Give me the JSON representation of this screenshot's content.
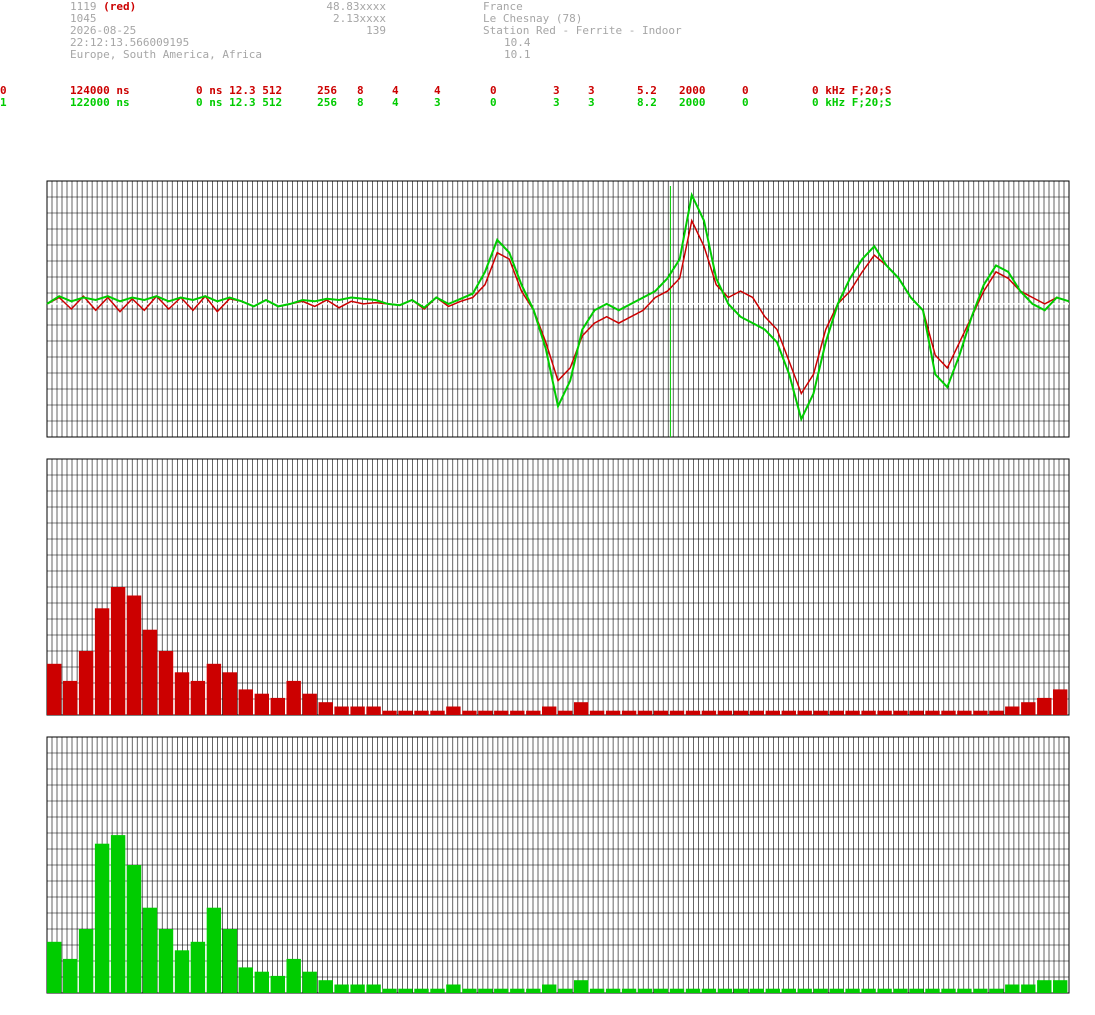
{
  "header": {
    "col1": [
      "1119",
      "1045",
      "2026-08-25",
      "22:12:13.566009195",
      "Europe, South America, Africa"
    ],
    "red_tag": "(red)",
    "col2": [
      "48.83xxxx",
      "2.13xxxx",
      "139"
    ],
    "col3": [
      "France",
      "Le Chesnay (78)",
      "Station Red - Ferrite - Indoor"
    ],
    "col3b": [
      "10.4",
      "10.1"
    ]
  },
  "channels": [
    {
      "id": "0",
      "f1": "124000 ns",
      "f2": "0 ns 12.3 512",
      "f3": "256",
      "f4": "8",
      "f5": "4",
      "f6": "4",
      "f7": "0",
      "f8": "3",
      "f9": "3",
      "f10": "5.2",
      "f11": "2000",
      "f12": "0",
      "f13": "0 kHz F;20;S"
    },
    {
      "id": "1",
      "f1": "122000 ns",
      "f2": "0 ns 12.3 512",
      "f3": "256",
      "f4": "8",
      "f5": "4",
      "f6": "3",
      "f7": "0",
      "f8": "3",
      "f9": "3",
      "f10": "8.2",
      "f11": "2000",
      "f12": "0",
      "f13": "0 kHz F;20;S"
    }
  ],
  "colors": {
    "red": "#cc0000",
    "green": "#00cc00",
    "grid": "#000000",
    "mid": "#ffffff"
  },
  "chart_data": [
    {
      "type": "line",
      "series": [
        {
          "key": "red",
          "values": [
            0,
            0.05,
            -0.04,
            0.06,
            -0.05,
            0.05,
            -0.06,
            0.04,
            -0.05,
            0.06,
            -0.04,
            0.05,
            -0.05,
            0.06,
            -0.06,
            0.04,
            0.02,
            -0.02,
            0.03,
            -0.02,
            0.0,
            0.02,
            -0.02,
            0.03,
            -0.03,
            0.02,
            0.0,
            0.01,
            0.0,
            -0.01,
            0.03,
            -0.04,
            0.05,
            -0.02,
            0.02,
            0.05,
            0.15,
            0.4,
            0.35,
            0.1,
            -0.05,
            -0.3,
            -0.6,
            -0.5,
            -0.25,
            -0.15,
            -0.1,
            -0.15,
            -0.1,
            -0.05,
            0.05,
            0.1,
            0.2,
            0.65,
            0.45,
            0.15,
            0.05,
            0.1,
            0.05,
            -0.1,
            -0.2,
            -0.45,
            -0.7,
            -0.55,
            -0.2,
            0.0,
            0.1,
            0.25,
            0.38,
            0.3,
            0.2,
            0.05,
            -0.05,
            -0.4,
            -0.5,
            -0.3,
            -0.1,
            0.1,
            0.25,
            0.2,
            0.1,
            0.05,
            0.0,
            0.05,
            0.02
          ]
        },
        {
          "key": "green",
          "values": [
            0,
            0.06,
            0.02,
            0.05,
            0.03,
            0.06,
            0.02,
            0.05,
            0.03,
            0.06,
            0.02,
            0.05,
            0.03,
            0.06,
            0.02,
            0.05,
            0.02,
            -0.02,
            0.03,
            -0.02,
            0.0,
            0.03,
            0.02,
            0.04,
            0.03,
            0.05,
            0.04,
            0.03,
            0.0,
            -0.01,
            0.03,
            -0.03,
            0.05,
            0.0,
            0.04,
            0.08,
            0.25,
            0.5,
            0.4,
            0.15,
            -0.05,
            -0.35,
            -0.8,
            -0.6,
            -0.2,
            -0.05,
            0.0,
            -0.05,
            0.0,
            0.05,
            0.1,
            0.2,
            0.35,
            0.85,
            0.65,
            0.2,
            0.0,
            -0.1,
            -0.15,
            -0.2,
            -0.3,
            -0.55,
            -0.9,
            -0.7,
            -0.3,
            0.0,
            0.2,
            0.35,
            0.45,
            0.3,
            0.2,
            0.05,
            -0.05,
            -0.55,
            -0.65,
            -0.4,
            -0.1,
            0.15,
            0.3,
            0.25,
            0.1,
            0.0,
            -0.05,
            0.05,
            0.02
          ]
        }
      ],
      "ylim": [
        -1,
        1
      ],
      "marker_fraction": 0.61
    },
    {
      "type": "bar",
      "series": [
        {
          "key": "red",
          "values": [
            0.12,
            0.08,
            0.15,
            0.25,
            0.3,
            0.28,
            0.2,
            0.15,
            0.1,
            0.08,
            0.12,
            0.1,
            0.06,
            0.05,
            0.04,
            0.08,
            0.05,
            0.03,
            0.02,
            0.02,
            0.02,
            0.01,
            0.01,
            0.01,
            0.01,
            0.02,
            0.01,
            0.01,
            0.01,
            0.01,
            0.01,
            0.02,
            0.01,
            0.03,
            0.01,
            0.01,
            0.01,
            0.01,
            0.01,
            0.01,
            0.01,
            0.01,
            0.01,
            0.01,
            0.01,
            0.01,
            0.01,
            0.01,
            0.01,
            0.01,
            0.01,
            0.01,
            0.01,
            0.01,
            0.01,
            0.01,
            0.01,
            0.01,
            0.01,
            0.01,
            0.02,
            0.03,
            0.04,
            0.06
          ]
        }
      ],
      "ylim": [
        0,
        0.6
      ]
    },
    {
      "type": "bar",
      "series": [
        {
          "key": "green",
          "values": [
            0.12,
            0.08,
            0.15,
            0.35,
            0.37,
            0.3,
            0.2,
            0.15,
            0.1,
            0.12,
            0.2,
            0.15,
            0.06,
            0.05,
            0.04,
            0.08,
            0.05,
            0.03,
            0.02,
            0.02,
            0.02,
            0.01,
            0.01,
            0.01,
            0.01,
            0.02,
            0.01,
            0.01,
            0.01,
            0.01,
            0.01,
            0.02,
            0.01,
            0.03,
            0.01,
            0.01,
            0.01,
            0.01,
            0.01,
            0.01,
            0.01,
            0.01,
            0.01,
            0.01,
            0.01,
            0.01,
            0.01,
            0.01,
            0.01,
            0.01,
            0.01,
            0.01,
            0.01,
            0.01,
            0.01,
            0.01,
            0.01,
            0.01,
            0.01,
            0.01,
            0.02,
            0.02,
            0.03,
            0.03
          ]
        }
      ],
      "ylim": [
        0,
        0.6
      ]
    }
  ]
}
